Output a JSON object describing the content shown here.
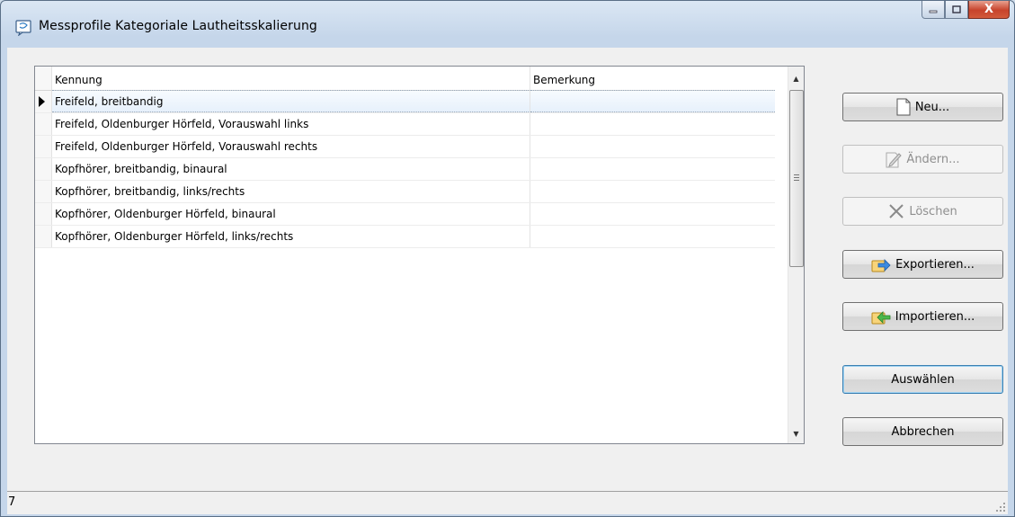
{
  "window": {
    "title": "Messprofile Kategoriale Lautheitsskalierung",
    "controls": {
      "minimize": "minimize-icon",
      "maximize": "maximize-icon",
      "close": "X"
    }
  },
  "grid": {
    "columns": [
      "Kennung",
      "Bemerkung"
    ],
    "rows": [
      {
        "kennung": "Freifeld, breitbandig",
        "bemerkung": ""
      },
      {
        "kennung": "Freifeld, Oldenburger Hörfeld, Vorauswahl links",
        "bemerkung": ""
      },
      {
        "kennung": "Freifeld, Oldenburger Hörfeld, Vorauswahl rechts",
        "bemerkung": ""
      },
      {
        "kennung": "Kopfhörer, breitbandig, binaural",
        "bemerkung": ""
      },
      {
        "kennung": "Kopfhörer, breitbandig, links/rechts",
        "bemerkung": ""
      },
      {
        "kennung": "Kopfhörer, Oldenburger Hörfeld, binaural",
        "bemerkung": ""
      },
      {
        "kennung": "Kopfhörer, Oldenburger Hörfeld, links/rechts",
        "bemerkung": ""
      }
    ],
    "current_row": 0
  },
  "buttons": {
    "new": "Neu...",
    "edit": "Ändern...",
    "delete": "Löschen",
    "export": "Exportieren...",
    "import": "Importieren...",
    "select": "Auswählen",
    "cancel": "Abbrechen"
  },
  "status": {
    "count": "7"
  },
  "colors": {
    "accent": "#3c7fb1",
    "close": "#c7432b",
    "disabled": "#8f8f8f"
  }
}
